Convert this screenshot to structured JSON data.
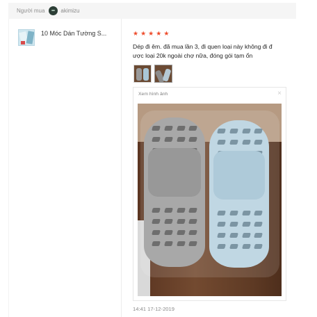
{
  "header": {
    "buyer_label": "Người mua",
    "username": "akimizu"
  },
  "product": {
    "name": "10 Móc Dán Tường S..."
  },
  "review": {
    "rating": 5,
    "star_glyph": "★",
    "star_color": "#ee4d2d",
    "text_line1": "Dép đi êm. đã mua lần 3, đi quen loại này không đi đ",
    "text_line2": "ược loại 20k ngoài chợ nữa, đóng gói tạm ổn",
    "timestamp": "14:41 17-12-2019"
  },
  "viewer": {
    "title": "Xem hình ảnh",
    "close_icon": "×"
  }
}
